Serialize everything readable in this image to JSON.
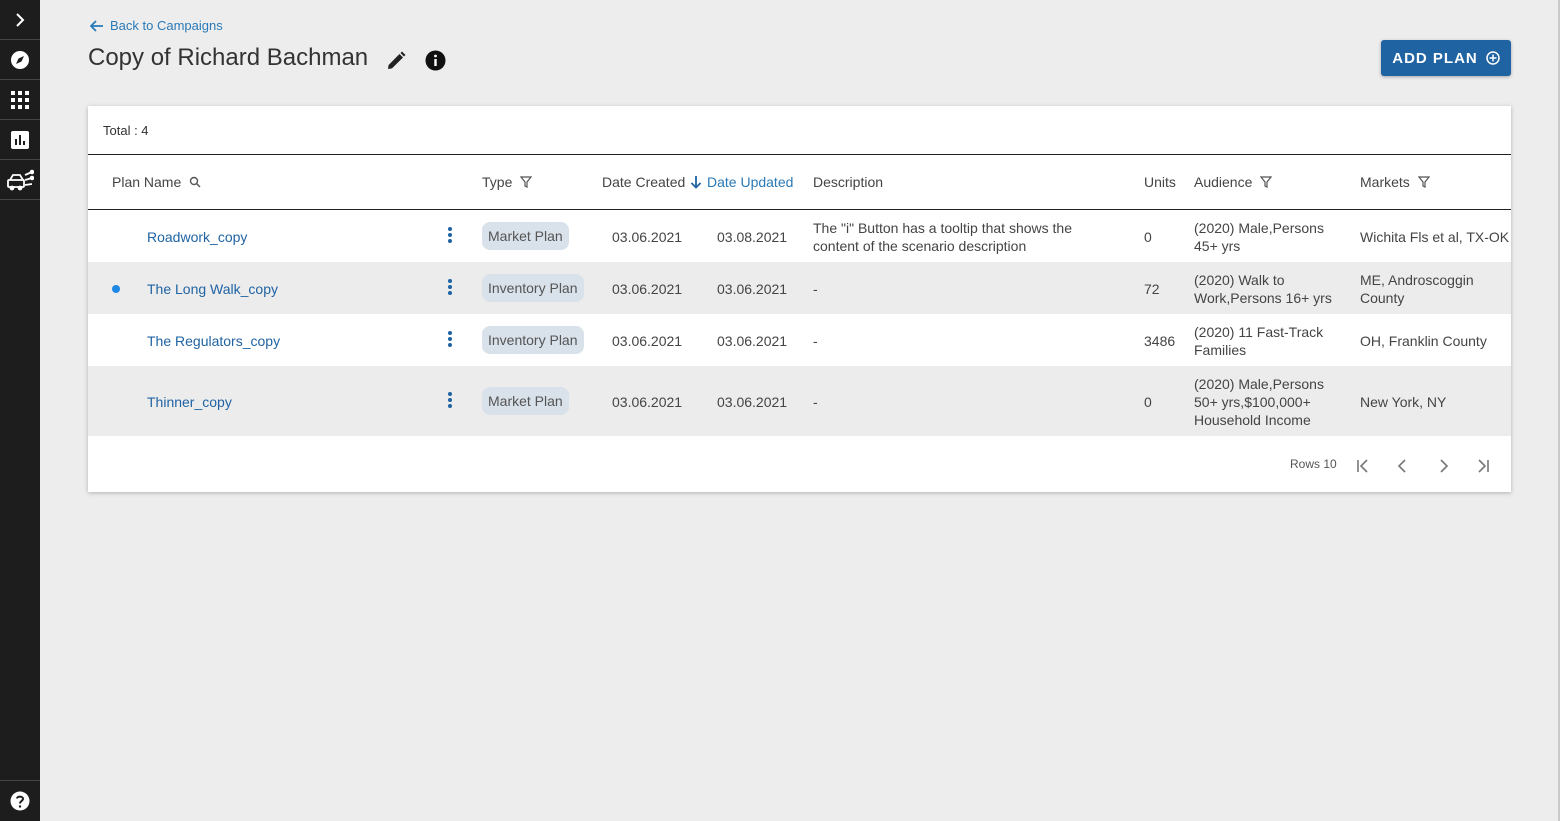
{
  "nav": {
    "back_label": "Back to Campaigns",
    "expand_icon": "chevron-right-icon",
    "items": [
      "compass-icon",
      "apps-grid-icon",
      "bar-chart-icon",
      "vehicles-icon"
    ],
    "help_icon": "help-icon"
  },
  "header": {
    "title": "Copy of Richard Bachman",
    "add_plan_label": "ADD PLAN"
  },
  "table": {
    "total_label": "Total : 4",
    "columns": {
      "plan_name": "Plan Name",
      "type": "Type",
      "date_created": "Date Created",
      "date_updated": "Date Updated",
      "description": "Description",
      "units": "Units",
      "audience": "Audience",
      "markets": "Markets"
    },
    "sorted_column": "Date Updated",
    "rows": [
      {
        "name": "Roadwork_copy",
        "type": "Market Plan",
        "created": "03.06.2021",
        "updated": "03.08.2021",
        "description_1": "The \"i\" Button has a tooltip that shows the",
        "description_2": "content of the scenario description",
        "units": "0",
        "audience_1": "(2020) Male,Persons",
        "audience_2": "45+ yrs",
        "audience_3": "",
        "markets_1": "Wichita Fls et al, TX-OK",
        "markets_2": "",
        "selected": false
      },
      {
        "name": "The Long Walk_copy",
        "type": "Inventory Plan",
        "created": "03.06.2021",
        "updated": "03.06.2021",
        "description_1": "-",
        "description_2": "",
        "units": "72",
        "audience_1": "(2020) Walk to",
        "audience_2": "Work,Persons 16+ yrs",
        "audience_3": "",
        "markets_1": "ME, Androscoggin",
        "markets_2": "County",
        "selected": true
      },
      {
        "name": "The Regulators_copy",
        "type": "Inventory Plan",
        "created": "03.06.2021",
        "updated": "03.06.2021",
        "description_1": "-",
        "description_2": "",
        "units": "3486",
        "audience_1": "(2020) 11 Fast-Track",
        "audience_2": "Families",
        "audience_3": "",
        "markets_1": "OH, Franklin County",
        "markets_2": "",
        "selected": false
      },
      {
        "name": "Thinner_copy",
        "type": "Market Plan",
        "created": "03.06.2021",
        "updated": "03.06.2021",
        "description_1": "-",
        "description_2": "",
        "units": "0",
        "audience_1": "(2020) Male,Persons",
        "audience_2": "50+ yrs,$100,000+",
        "audience_3": "Household Income",
        "markets_1": "New York, NY",
        "markets_2": "",
        "selected": false
      }
    ],
    "pagination": {
      "rows_label": "Rows 10"
    }
  },
  "colors": {
    "accent": "#1f63a3",
    "link": "#2a7ab8",
    "sidebar": "#1d1d1d",
    "chip": "#d9e1ea"
  }
}
